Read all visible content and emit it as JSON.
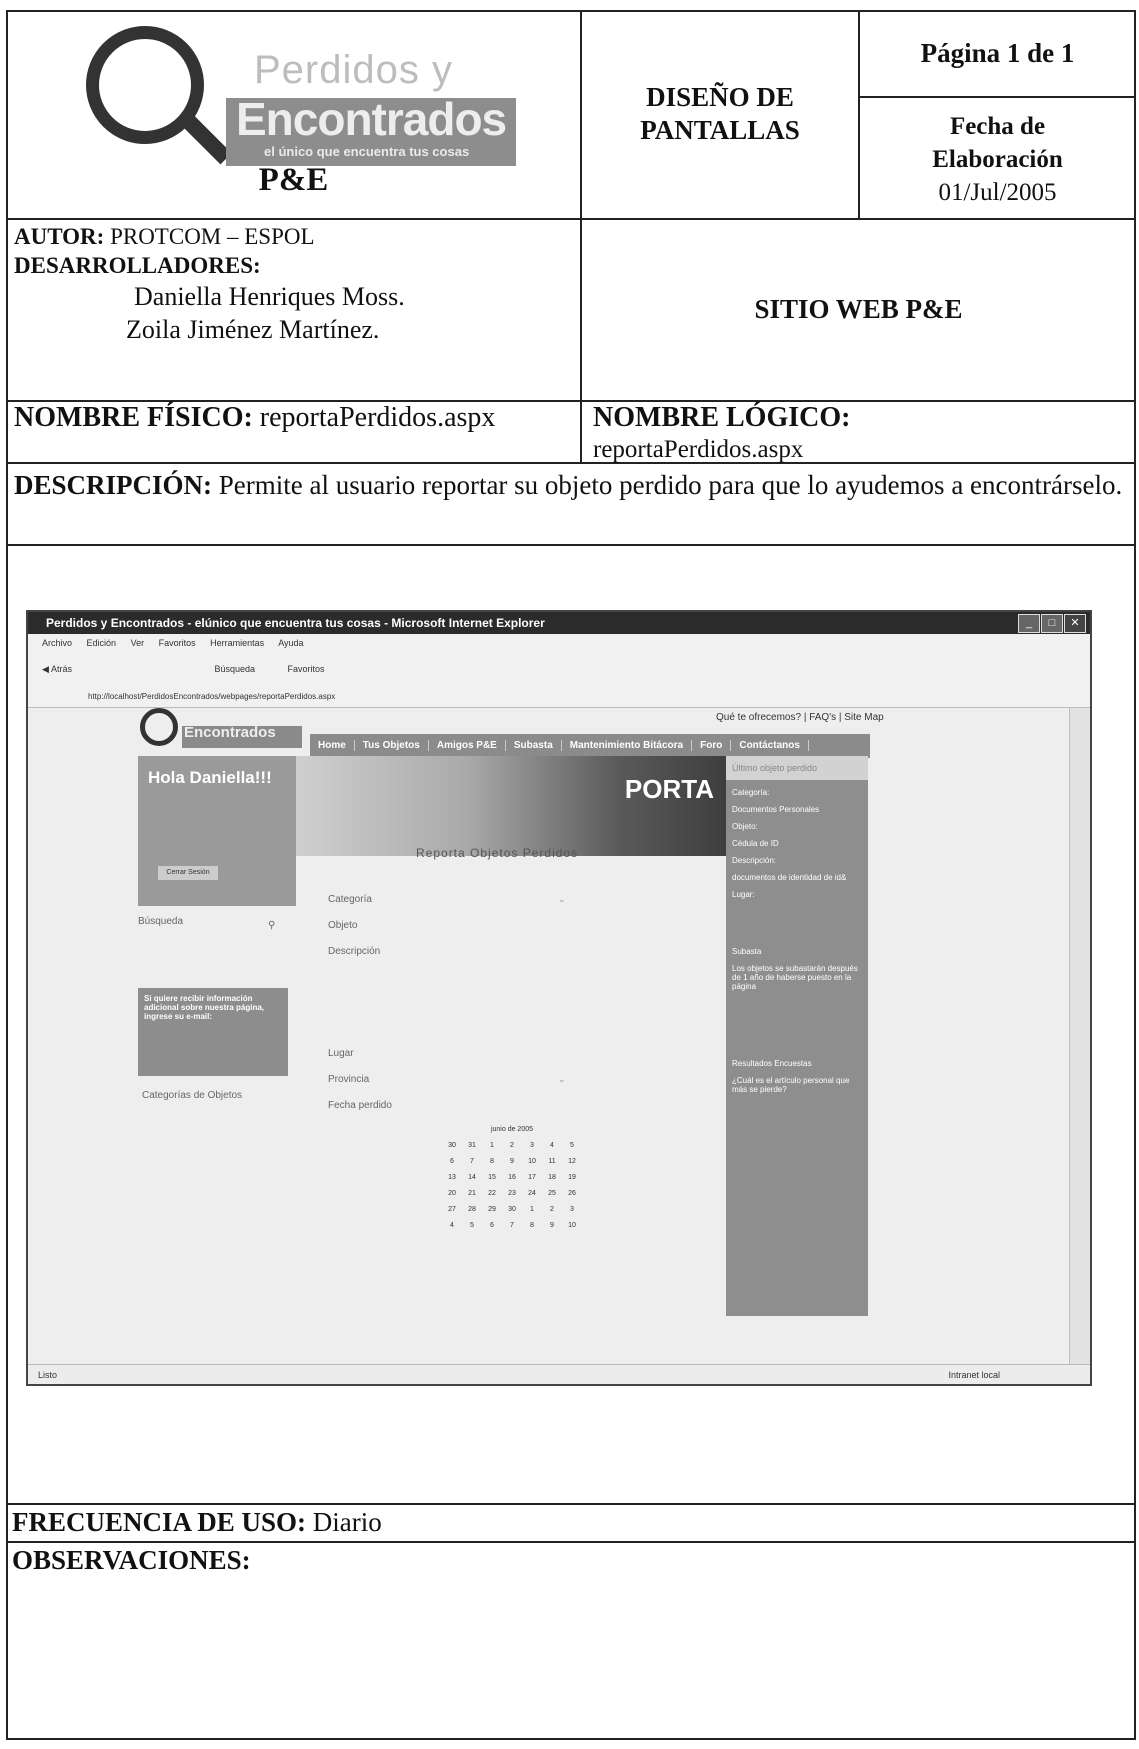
{
  "header": {
    "logo": {
      "line1": "Perdidos y",
      "line2": "Encontrados",
      "tagline": "el único que encuentra tus cosas"
    },
    "company": "P&E",
    "doc_type_line1": "DISEÑO DE",
    "doc_type_line2": "PANTALLAS",
    "page": "Página 1 de 1",
    "date_label_line1": "Fecha de",
    "date_label_line2": "Elaboración",
    "date_value": "01/Jul/2005"
  },
  "authors": {
    "autor_label": "AUTOR:",
    "autor_value": " PROTCOM – ESPOL",
    "dev_label": "DESARROLLADORES:",
    "dev1": "Daniella Henriques Moss.",
    "dev2": "Zoila Jiménez Martínez."
  },
  "site": "SITIO WEB P&E",
  "names": {
    "fisico_label": "NOMBRE FÍSICO:",
    "fisico_value": " reportaPerdidos.aspx",
    "logico_label": "NOMBRE LÓGICO:",
    "logico_value": "reportaPerdidos.aspx"
  },
  "description": {
    "label": "DESCRIPCIÓN:",
    "text": " Permite al usuario reportar su objeto perdido para que lo ayudemos a encontrárselo."
  },
  "screenshot": {
    "window_title": "Perdidos y Encontrados - elúnico que encuentra tus cosas - Microsoft Internet Explorer",
    "menu": [
      "Archivo",
      "Edición",
      "Ver",
      "Favoritos",
      "Herramientas",
      "Ayuda"
    ],
    "toolbar": [
      "Atrás",
      "Búsqueda",
      "Favoritos"
    ],
    "address": "http://localhost/PerdidosEncontrados/webpages/reportaPerdidos.aspx",
    "top_links": "Qué te ofrecemos? | FAQ's | Site Map",
    "site_logo": "Encontrados",
    "nav": [
      "Home",
      "Tus Objetos",
      "Amigos P&E",
      "Subasta",
      "Mantenimiento Bitácora",
      "Foro",
      "Contáctanos"
    ],
    "greeting": "Hola Daniella!!!",
    "logout": "Cerrar Sesión",
    "banner_text": "PORTA",
    "ultimo": "Último objeto perdido",
    "right_items": [
      "Categoría:",
      "Documentos Personales",
      "Objeto:",
      "Cédula de ID",
      "Descripción:",
      "documentos de identidad de id&",
      "Lugar:",
      "Subasta",
      "Los objetos se subastarán después de 1 año de haberse puesto en la página",
      "Resultados Encuestas",
      "¿Cuál es el artículo personal que más se pierde?"
    ],
    "form_title": "Reporta Objetos Perdidos",
    "labels": [
      "Categoría",
      "Objeto",
      "Descripción",
      "Lugar",
      "Provincia",
      "Fecha perdido"
    ],
    "left_labels": [
      "Búsqueda",
      "Categorías de Objetos"
    ],
    "info_box": "Si quiere recibir información adicional sobre nuestra página, ingrese su e-mail:",
    "calendar_title": "junio de 2005",
    "calendar_rows": [
      [
        "30",
        "31",
        "1",
        "2",
        "3",
        "4",
        "5"
      ],
      [
        "6",
        "7",
        "8",
        "9",
        "10",
        "11",
        "12"
      ],
      [
        "13",
        "14",
        "15",
        "16",
        "17",
        "18",
        "19"
      ],
      [
        "20",
        "21",
        "22",
        "23",
        "24",
        "25",
        "26"
      ],
      [
        "27",
        "28",
        "29",
        "30",
        "1",
        "2",
        "3"
      ],
      [
        "4",
        "5",
        "6",
        "7",
        "8",
        "9",
        "10"
      ]
    ],
    "status_left": "Listo",
    "status_right": "Intranet local"
  },
  "frequency": {
    "label": "FRECUENCIA DE USO:",
    "value": " Diario"
  },
  "observaciones_label": "OBSERVACIONES:"
}
